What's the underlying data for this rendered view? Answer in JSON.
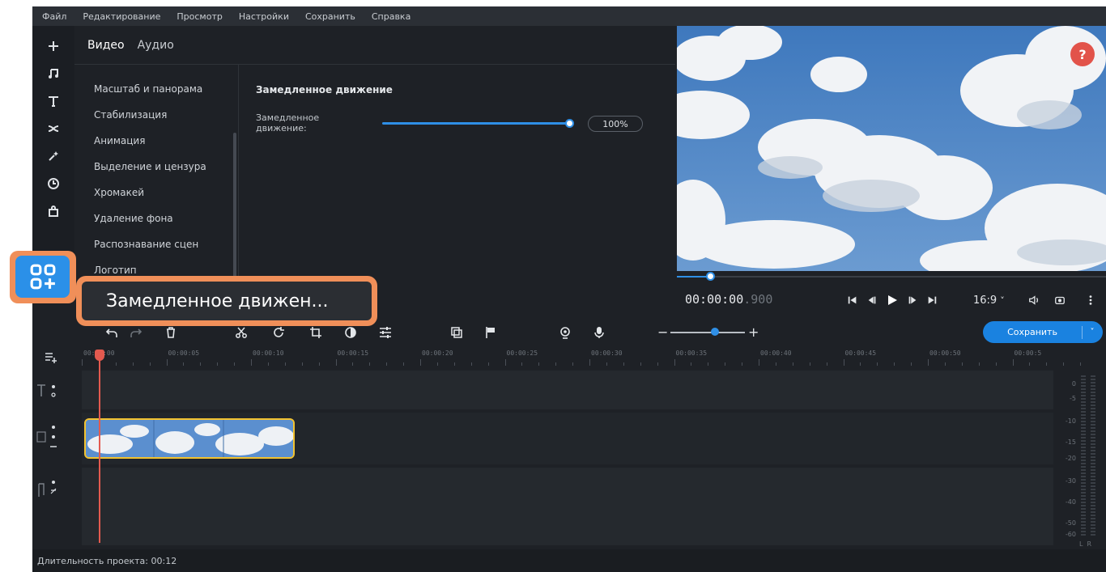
{
  "menu": [
    "Файл",
    "Редактирование",
    "Просмотр",
    "Настройки",
    "Сохранить",
    "Справка"
  ],
  "panel": {
    "tabs": [
      "Видео",
      "Аудио"
    ],
    "tools": [
      "Масштаб и панорама",
      "Стабилизация",
      "Анимация",
      "Выделение и цензура",
      "Хромакей",
      "Удаление фона",
      "Распознавание сцен",
      "Логотип"
    ]
  },
  "settings": {
    "title": "Замедленное движение",
    "slider_label": "Замедленное движение:",
    "slider_value": "100%",
    "slider_level": 1.0
  },
  "tooltip": {
    "text": "Замедленное движен..."
  },
  "preview": {
    "help": "?",
    "time_main": "00:00:00",
    "time_ms": ".900",
    "aspect": "16:9",
    "aspect_caret": "˅",
    "progress": 0.08
  },
  "toolbar": {
    "zoom_minus": "−",
    "zoom_plus": "+",
    "save_label": "Сохранить",
    "save_caret": "˅"
  },
  "timeline": {
    "ticks": [
      "00:00:00",
      "00:00:05",
      "00:00:10",
      "00:00:15",
      "00:00:20",
      "00:00:25",
      "00:00:30",
      "00:00:35",
      "00:00:40",
      "00:00:45",
      "00:00:50",
      "00:00:5"
    ],
    "meter_labels": [
      "0",
      "-5",
      "-10",
      "-15",
      "-20",
      "-30",
      "-40",
      "-50",
      "-60"
    ],
    "meter_channels": "L  R"
  },
  "status": {
    "duration": "Длительность проекта: 00:12"
  },
  "colors": {
    "accent": "#2f8fe6",
    "highlight": "#f08f59",
    "clip_border": "#f2c230",
    "playhead": "#e35a4f"
  }
}
